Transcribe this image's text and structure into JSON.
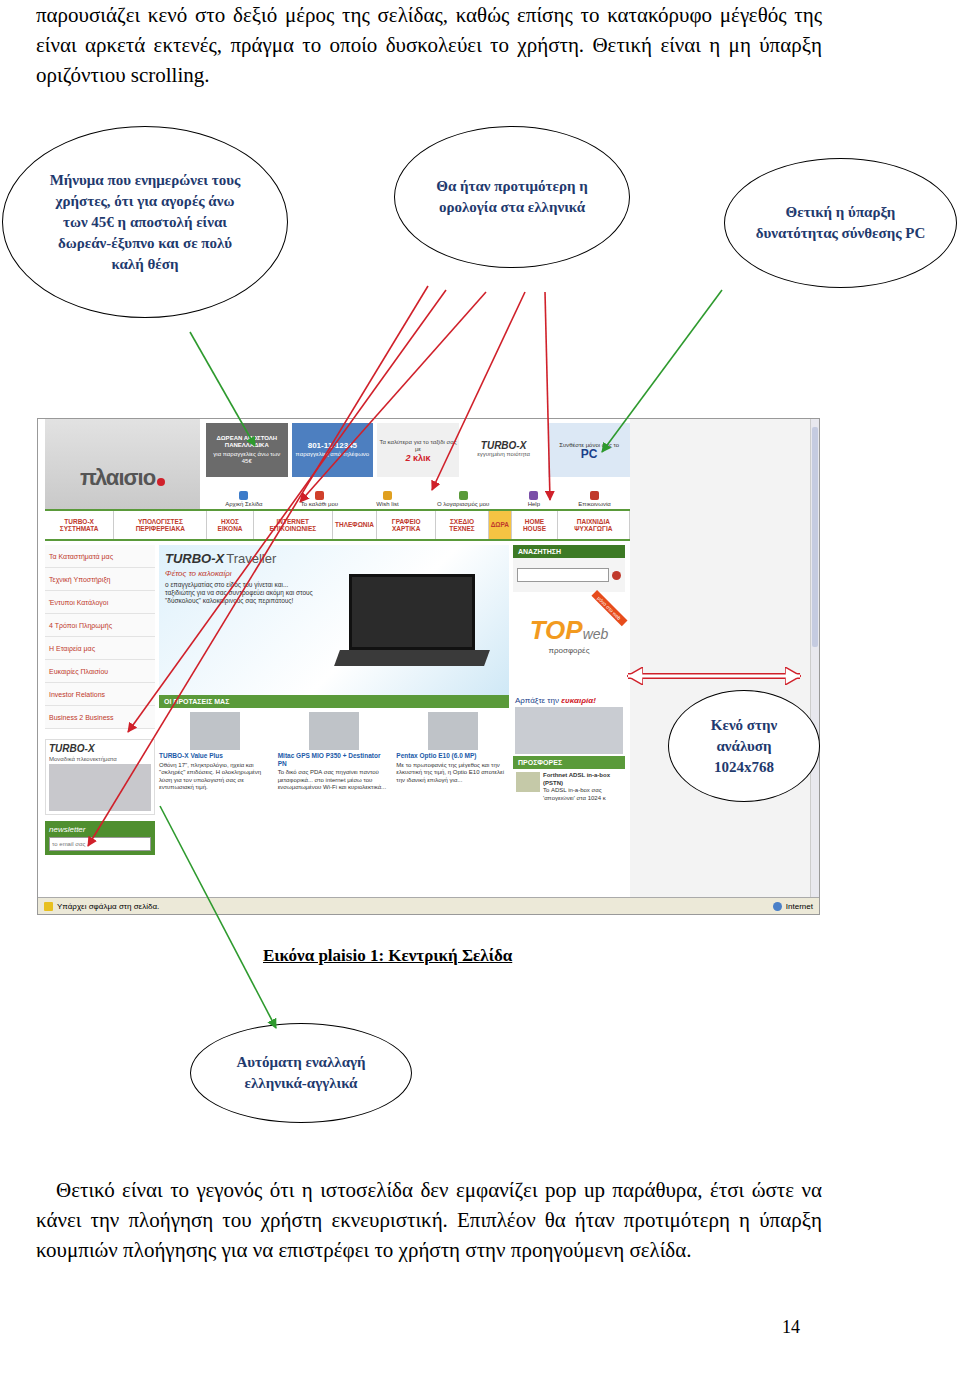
{
  "intro": "παρουσιάζει κενό στο δεξιό μέρος της σελίδας, καθώς επίσης το κατακόρυφο μέγεθός της είναι αρκετά εκτενές, πράγμα το οποίο δυσκολεύει το χρήστη. Θετική είναι η μη ύπαρξη οριζόντιου scrolling.",
  "callouts": {
    "free_shipping": "Μήνυμα που ενημερώνει τους χρήστες, ότι για αγορές άνω των 45€ η αποστολή είναι δωρεάν-έξυπνο και σε πολύ καλή θέση",
    "terminology": "Θα ήταν προτιμότερη η ορολογία στα ελληνικά",
    "pc_builder": "Θετική η ύπαρξη δυνατότητας σύνθεσης PC",
    "resolution_gap": "Κενό στην ανάλυση 1024x768",
    "language_switch": "Αυτόματη εναλλαγή ελληνικά-αγγλικά"
  },
  "caption": "Εικόνα plaisio 1: Κεντρική Σελίδα",
  "closing": "Θετικό είναι το γεγονός ότι η ιστοσελίδα δεν εμφανίζει pop up παράθυρα, έτσι ώστε να κάνει την πλοήγηση του χρήστη εκνευριστική. Επιπλέον θα ήταν προτιμότερη η ύπαρξη κουμπιών πλοήγησης για να επιστρέφει το χρήστη στην προηγούμενη σελίδα.",
  "page_number": "14",
  "site": {
    "logo": "πλαισιο",
    "promo": {
      "title": "ΔΩΡΕΑΝ ΑΠΟΣΤΟΛΗ ΠΑΝΕΛΛΑΔΙΚΑ",
      "note": "για παραγγελίες άνω των 45€"
    },
    "phone": {
      "number": "801-11-12345",
      "note": "παραγγελίες από τηλέφωνο"
    },
    "travel": {
      "title": "Τα καλύτερα για το ταξίδι σας με",
      "count": "2",
      "unit": "κλικ"
    },
    "turbo_banner": {
      "brand": "TURBO-X",
      "note": "εγγυημένη ποιότητα"
    },
    "pc_banner": {
      "title": "Συνθέστε μόνοι σας το",
      "pc": "PC"
    },
    "toolbar": [
      {
        "label": "Αρχική Σελίδα",
        "color": "#3d7cc9"
      },
      {
        "label": "Το καλάθι μου",
        "color": "#d0402b"
      },
      {
        "label": "Wish list",
        "color": "#e0a020"
      },
      {
        "label": "Ο λογαριασμός μου",
        "color": "#5a9a3a"
      },
      {
        "label": "Help",
        "color": "#7a4fa8"
      },
      {
        "label": "Επικοινωνία",
        "color": "#c0392b"
      }
    ],
    "categories": [
      {
        "label": "TURBO-X ΣΥΣΤΗΜΑΤΑ",
        "selected": false
      },
      {
        "label": "ΥΠΟΛΟΓΙΣΤΕΣ ΠΕΡΙΦΕΡΕΙΑΚΑ",
        "selected": false
      },
      {
        "label": "ΗΧΟΣ ΕΙΚΟΝΑ",
        "selected": false
      },
      {
        "label": "INTERNET ΕΠΙΚΟΙΝΩΝΙΕΣ",
        "selected": false
      },
      {
        "label": "ΤΗΛΕΦΩΝΙΑ",
        "selected": false
      },
      {
        "label": "ΓΡΑΦΕΙΟ ΧΑΡΤΙΚΑ",
        "selected": false
      },
      {
        "label": "ΣΧΕΔΙΟ ΤΕΧΝΕΣ",
        "selected": false
      },
      {
        "label": "ΔΩΡΑ",
        "selected": true
      },
      {
        "label": "HOME HOUSE",
        "selected": false
      },
      {
        "label": "ΠΑΙΧΝΙΔΙΑ ΨΥΧΑΓΩΓΙΑ",
        "selected": false
      }
    ],
    "side_menu": [
      "Τα Καταστήματά μας",
      "Τεχνική Υποστήριξη",
      "Έντυποι Κατάλογοι",
      "4 Τρόποι Πληρωμής",
      "Η Εταιρεία μας",
      "Ευκαιρίες Πλαισίου",
      "Investor Relations",
      "Business 2 Business"
    ],
    "side_promo": {
      "brand": "TURBO-X",
      "note": "Μοναδικά πλεονεκτήματα"
    },
    "newsletter": {
      "title": "newsletter",
      "placeholder": "το email σας"
    },
    "hero": {
      "brand": "TURBO-X",
      "model": "Traveller",
      "tagline": "Φέτος το καλοκαίρι",
      "copy": "ο επαγγελματίας στο είδος του γίνεται και... ταξιδιώτης για να σας συντροφεύει ακόμη και στους \"δύσκολους\" καλοκαιρινούς σας περιπάτους!"
    },
    "proposals": {
      "title": "ΟΙ ΠΡΟΤΑΣΕΙΣ ΜΑΣ",
      "items": [
        {
          "name": "TURBO-X Value Plus",
          "text": "Οθόνη 17\", πληκτρολόγιο, ηχεία και \"σκληρές\" επιδόσεις. Η ολοκληρωμένη λύση για τον υπολογιστή σας σε εντυπωσιακή τιμή."
        },
        {
          "name": "Mitac GPS MIO P350 + Destinator PN",
          "text": "Το δικό σας PDA σας πηγαίνει παντού μεταφορικά... στο internet μέσω του ενσωματωμένου Wi-Fi και κυριολεκτικά..."
        },
        {
          "name": "Pentax Optio E10 (6.0 MP)",
          "text": "Με το πρωτοφανές της μέγεθος και την ελκυστική της τιμή, η Optio E10 αποτελεί την ιδανική επιλογή για..."
        }
      ]
    },
    "search": {
      "title": "ΑΝΑΖΗΤΗΣΗ"
    },
    "top_web": {
      "top": "TOP",
      "web": "web",
      "sub": "προσφορές",
      "badge": "μόνο στο web"
    },
    "bargain": {
      "text": "Αρπάξτε την",
      "highlight": "ευκαιρία!"
    },
    "offers": {
      "title": "ΠΡΟΣΦΟΡΕΣ",
      "name": "Forthnet ADSL in-a-box (PSTN)",
      "text": "Το ADSL in-a-box σας 'απογειώνει' στα 1024 κ"
    },
    "status": {
      "message": "Υπάρχει σφάλμα στη σελίδα.",
      "zone": "Internet"
    }
  }
}
